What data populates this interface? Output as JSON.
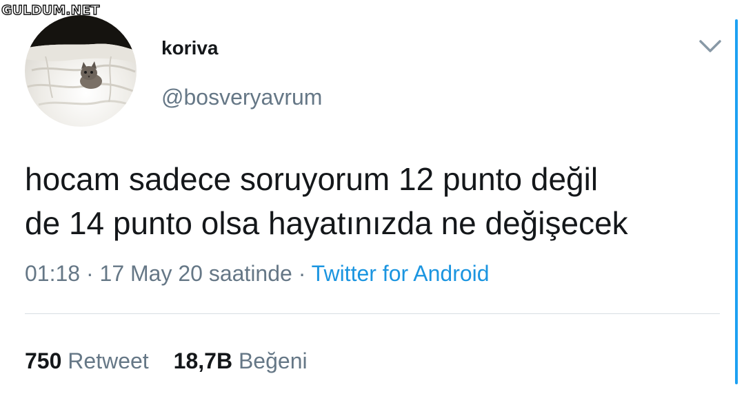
{
  "watermark": "GULDUM.NET",
  "user": {
    "display_name": "koriva",
    "handle": "@bosveryavrum"
  },
  "tweet": {
    "text_line1": "hocam sadece soruyorum 12 punto değil",
    "text_line2": "de 14 punto olsa hayatınızda ne değişecek",
    "time": "01:18",
    "separator": "·",
    "date": "17 May 20 saatinde",
    "source": "Twitter for Android"
  },
  "stats": {
    "retweet_count": "750",
    "retweet_label": "Retweet",
    "like_count": "18,7B",
    "like_label": "Beğeni"
  },
  "icons": {
    "menu": "chevron-down-icon",
    "avatar": "cat-on-bed-photo"
  },
  "colors": {
    "text": "#14171a",
    "secondary": "#657786",
    "link": "#1b95e0",
    "divider": "#d7dde2"
  }
}
